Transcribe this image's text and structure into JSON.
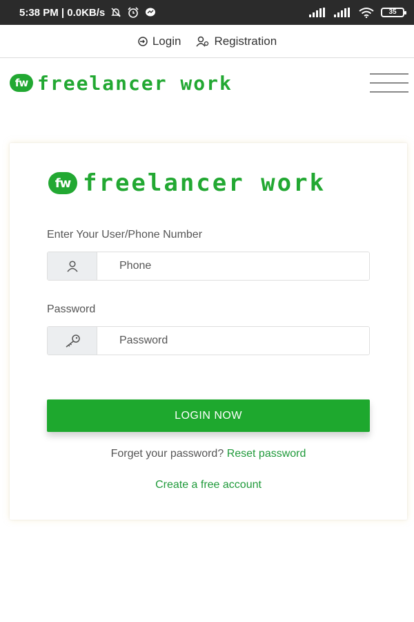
{
  "status_bar": {
    "time_network": "5:38 PM | 0.0KB/s",
    "battery": "35"
  },
  "top_links": {
    "login": "Login",
    "registration": "Registration"
  },
  "header": {
    "logo_badge": "fw",
    "logo_text": "freelancer work"
  },
  "card": {
    "logo_badge": "fw",
    "logo_text": "freelancer work",
    "user_label": "Enter Your User/Phone Number",
    "phone_placeholder": "Phone",
    "password_label": "Password",
    "password_placeholder": "Password",
    "login_button": "LOGIN NOW",
    "forgot_text": "Forget your password?",
    "reset_link": "Reset password",
    "create_account": "Create a free account"
  },
  "colors": {
    "brand_green": "#22a832",
    "button_green": "#1ea82e",
    "link_green": "#1f9a3a"
  }
}
